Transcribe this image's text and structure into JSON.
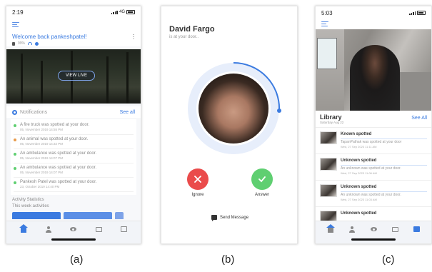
{
  "captions": {
    "a": "(a)",
    "b": "(b)",
    "c": "(c)"
  },
  "colors": {
    "accent": "#3b7be0",
    "ignore": "#ea4b4b",
    "answer": "#5fcf71"
  },
  "screen_a": {
    "status": {
      "time": "2:19",
      "network": "4G"
    },
    "welcome": "Welcome back pankeshpatel!",
    "device_battery": "99%",
    "view_live_label": "VIEW LIVE",
    "notifications_title": "Notifications",
    "see_all": "See all",
    "notifications": [
      {
        "text": "A fire truck was spotted at your door.",
        "time": "05, November 2019 14:55 PM",
        "color": "#5fcf71"
      },
      {
        "text": "An animal was spotted at your door.",
        "time": "05, November 2019 14:32 PM",
        "color": "#e89b4b"
      },
      {
        "text": "An ambulance was spotted at your door.",
        "time": "05, November 2019 14:07 PM",
        "color": "#5fcf71"
      },
      {
        "text": "An ambulance was spotted at your door.",
        "time": "05, November 2019 14:07 PM",
        "color": "#5fcf71"
      },
      {
        "text": "Pankesh Patel was spotted at your door.",
        "time": "23, October 2019 14:40 PM",
        "color": "#5fcf71"
      }
    ],
    "activity_title": "Activity Statistics",
    "activity_sub": "This week activities",
    "tabs": [
      "home-icon",
      "user-icon",
      "eye-icon",
      "image-icon",
      "library-icon"
    ]
  },
  "screen_b": {
    "caller_name": "David Fargo",
    "caller_status": "is at your door..",
    "ignore_label": "Ignore",
    "answer_label": "Answer",
    "send_message_label": "Send Message"
  },
  "screen_c": {
    "status": {
      "time": "5:03"
    },
    "library_title": "Library",
    "library_date": "Saturday Aug 22",
    "see_all": "See All",
    "items": [
      {
        "label": "Known spotted",
        "msg": "TapanPathak was spotted at your door",
        "time": "Wed, 27 Sep 2023 11:11 AM"
      },
      {
        "label": "Unknown spotted",
        "msg": "An unknown was spotted at your door.",
        "time": "Wed, 27 Sep 2023 11:06 AM"
      },
      {
        "label": "Unknown spotted",
        "msg": "An unknown was spotted at your door.",
        "time": "Wed, 27 Sep 2023 11:03 AM"
      },
      {
        "label": "Unknown spotted",
        "msg": "",
        "time": ""
      }
    ],
    "tabs": [
      "home-icon",
      "user-icon",
      "eye-icon",
      "image-icon",
      "library-icon"
    ]
  }
}
